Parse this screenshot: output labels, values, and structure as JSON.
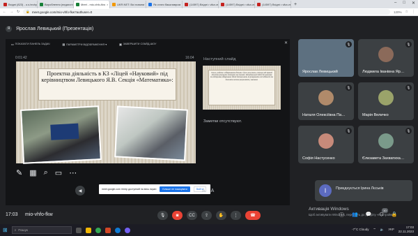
{
  "tabs": [
    {
      "label": "Вхідні (823) - o.s.techyshy",
      "color": "#c5221f"
    },
    {
      "label": "Вироблення (педагогічні)",
      "color": "#188038"
    },
    {
      "label": "Meet - mio-vhfo-fkw",
      "color": "#188038",
      "active": true
    },
    {
      "label": "UKR.NET: Всі новини України",
      "color": "#f29900"
    },
    {
      "label": "Як стати бакалавром",
      "color": "#1a73e8"
    },
    {
      "label": "(14597) Вхідні • vika.veche",
      "color": "#c5221f"
    },
    {
      "label": "(14597) Вхідні • vika.veche",
      "color": "#c5221f"
    },
    {
      "label": "(14597) Вхідні • vika.veche",
      "color": "#c5221f"
    }
  ],
  "browser": {
    "url": "meet.google.com/mio-vhfo-fkw?authuser=0",
    "zoom": "120%",
    "new_tab": "+"
  },
  "meeting": {
    "presenter_title": "Ярослав Левицький (Презентація)",
    "presenter_initial": "Я",
    "code": "mio-vhfo-fkw",
    "time": "17:03"
  },
  "presenter_toolbar": {
    "taskbar": "ПОКАЗАТИ ПАНЕЛЬ ЗАДАЧ",
    "options": "ПАРАМЕТРИ ВІДОБРАЖЕННЯ ▾",
    "end": "ЗАВЕРШИТИ СЛАЙД-ШОУ",
    "elapsed": "0:01:42",
    "clock": "16:04"
  },
  "slide": {
    "title": "Проектна діяльність в КЗ «Ліцей «Науковий» під керівництвом Левицького Я.В. Секція «Математика»:"
  },
  "next_slide": {
    "label": "Наступний слайд",
    "text": "Отже, робота з обдарованими дітьми є дуже важливою, оскільки мій прямий обов'язок розвинути потенціал та талант. Індивідуальний підхід до навчання та підтримка обдарованих дітей допомагають їм розкривати свої здібності та досягати високих результатів у навчанні."
  },
  "notes": "Заметки отсутствуют.",
  "toast": {
    "text": "meet.google.com тепер доступний на весь екран",
    "hide": "Більше не показувати",
    "exit": "Вийти"
  },
  "slide_counter": "",
  "participants": [
    {
      "name": "Ярослав Левицький",
      "color": "#5d7080"
    },
    {
      "name": "Людмила Іванівна Яр…",
      "color": "#8b6a5a"
    },
    {
      "name": "Наталя Олексіївна Па…",
      "color": "#b08a6a"
    },
    {
      "name": "Марія Величко",
      "color": "#9aa36a"
    },
    {
      "name": "Софія Настусенко",
      "color": "#c78a7a"
    },
    {
      "name": "Єлизавета Захватиха…",
      "color": "#7a9a8a"
    }
  ],
  "joining": {
    "initial": "І",
    "text": "Приєднується Ірина Лєськів"
  },
  "activation": {
    "title": "Активація Windows",
    "sub": "Щоб активувати Windows, перейдіть до розділу «Настройки»."
  },
  "participants_count": "10",
  "taskbar": {
    "search": "Пошук",
    "weather": "-7°C Cloudy",
    "lang": "УКР",
    "time": "17:03",
    "date": "22.11.2023"
  }
}
